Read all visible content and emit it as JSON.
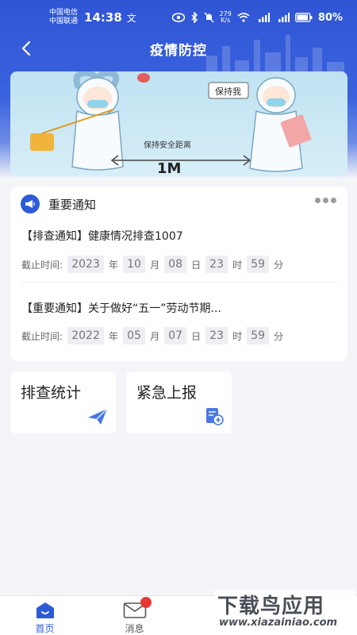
{
  "status_bar": {
    "carrier_top": "中国电信",
    "carrier_bottom": "中国联通",
    "time": "14:38",
    "extra": "文",
    "net_speed_value": "279",
    "net_speed_unit": "K/s",
    "battery": "80%"
  },
  "header": {
    "title": "疫情防控"
  },
  "banner": {
    "sign_text": "保持我",
    "arrow_text": "保持安全距离",
    "distance_text": "1M"
  },
  "notices": {
    "title": "重要通知",
    "items": [
      {
        "text": "【排查通知】健康情况排查1007",
        "deadline_label": "截止时间:",
        "year": "2023",
        "month": "10",
        "day": "08",
        "hour": "23",
        "minute": "59"
      },
      {
        "text": "【重要通知】关于做好“五一”劳动节期...",
        "deadline_label": "截止时间:",
        "year": "2022",
        "month": "05",
        "day": "07",
        "hour": "23",
        "minute": "59"
      }
    ],
    "units": {
      "year": "年",
      "month": "月",
      "day": "日",
      "hour": "时",
      "minute": "分"
    }
  },
  "quick_actions": [
    {
      "label": "排查统计",
      "icon": "paper-plane-icon"
    },
    {
      "label": "紧急上报",
      "icon": "report-upload-icon"
    }
  ],
  "tab_bar": {
    "tabs": [
      {
        "label": "首页",
        "icon": "home-icon",
        "active": true
      },
      {
        "label": "消息",
        "icon": "mail-icon",
        "active": false
      }
    ]
  },
  "watermark": {
    "main": "下载鸟应用",
    "sub": "www.xiazainiao.com"
  },
  "colors": {
    "primary": "#2d5bd8",
    "header_gradient_top": "#2f55d4",
    "badge": "#e53935",
    "background": "#f4f5f9"
  }
}
